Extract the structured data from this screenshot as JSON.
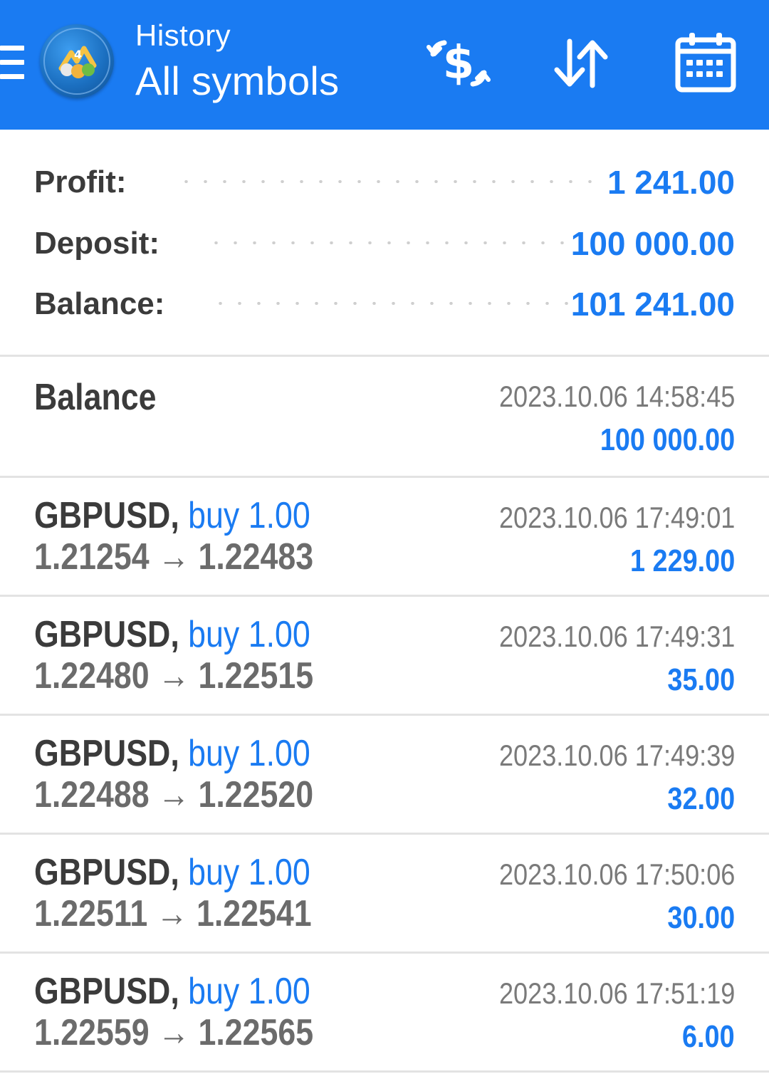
{
  "header": {
    "title": "History",
    "subtitle": "All symbols",
    "icons": {
      "menu": "hamburger-menu-icon",
      "logo": "metatrader-logo",
      "currency": "dollar-exchange-icon",
      "sort": "sort-arrows-icon",
      "calendar": "calendar-icon"
    },
    "colors": {
      "bar": "#1a7bf2",
      "text": "#ffffff"
    }
  },
  "summary": {
    "profit_label": "Profit:",
    "profit_value": "1 241.00",
    "deposit_label": "Deposit:",
    "deposit_value": "100 000.00",
    "balance_label": "Balance:",
    "balance_value": "101 241.00"
  },
  "history": {
    "balance_entry": {
      "label": "Balance",
      "time": "2023.10.06 14:58:45",
      "amount": "100 000.00"
    },
    "deals": [
      {
        "symbol": "GBPUSD,",
        "type": "buy",
        "volume": "1.00",
        "open_price": "1.21254",
        "arrow": "→",
        "close_price": "1.22483",
        "time": "2023.10.06 17:49:01",
        "profit": "1 229.00"
      },
      {
        "symbol": "GBPUSD,",
        "type": "buy",
        "volume": "1.00",
        "open_price": "1.22480",
        "arrow": "→",
        "close_price": "1.22515",
        "time": "2023.10.06 17:49:31",
        "profit": "35.00"
      },
      {
        "symbol": "GBPUSD,",
        "type": "buy",
        "volume": "1.00",
        "open_price": "1.22488",
        "arrow": "→",
        "close_price": "1.22520",
        "time": "2023.10.06 17:49:39",
        "profit": "32.00"
      },
      {
        "symbol": "GBPUSD,",
        "type": "buy",
        "volume": "1.00",
        "open_price": "1.22511",
        "arrow": "→",
        "close_price": "1.22541",
        "time": "2023.10.06 17:50:06",
        "profit": "30.00"
      },
      {
        "symbol": "GBPUSD,",
        "type": "buy",
        "volume": "1.00",
        "open_price": "1.22559",
        "arrow": "→",
        "close_price": "1.22565",
        "time": "2023.10.06 17:51:19",
        "profit": "6.00"
      }
    ]
  }
}
